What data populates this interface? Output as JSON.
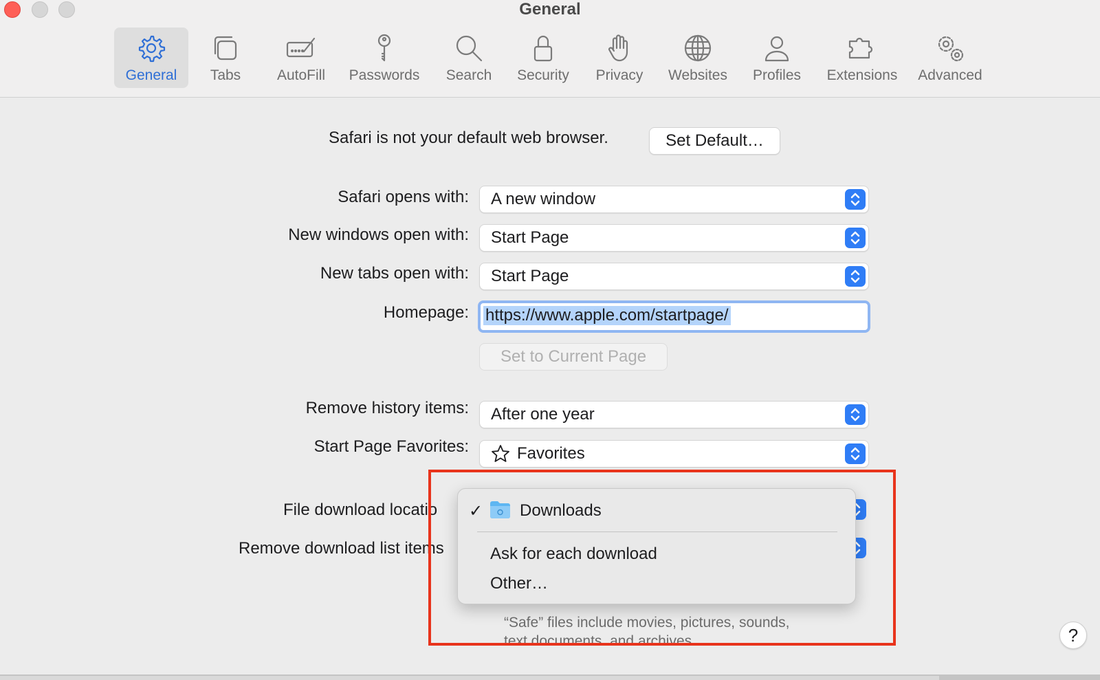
{
  "window": {
    "title": "General"
  },
  "toolbar": {
    "tabs": [
      {
        "label": "General",
        "icon": "gear-icon",
        "active": true
      },
      {
        "label": "Tabs",
        "icon": "tabs-icon"
      },
      {
        "label": "AutoFill",
        "icon": "autofill-icon"
      },
      {
        "label": "Passwords",
        "icon": "key-icon"
      },
      {
        "label": "Search",
        "icon": "magnifier-icon"
      },
      {
        "label": "Security",
        "icon": "lock-icon"
      },
      {
        "label": "Privacy",
        "icon": "hand-icon"
      },
      {
        "label": "Websites",
        "icon": "globe-icon"
      },
      {
        "label": "Profiles",
        "icon": "person-icon"
      },
      {
        "label": "Extensions",
        "icon": "puzzle-icon"
      },
      {
        "label": "Advanced",
        "icon": "gears-icon"
      }
    ]
  },
  "default_browser": {
    "message": "Safari is not your default web browser.",
    "button": "Set Default…"
  },
  "settings": {
    "opens_with": {
      "label": "Safari opens with:",
      "value": "A new window"
    },
    "new_windows": {
      "label": "New windows open with:",
      "value": "Start Page"
    },
    "new_tabs": {
      "label": "New tabs open with:",
      "value": "Start Page"
    },
    "homepage": {
      "label": "Homepage:",
      "value": "https://www.apple.com/startpage/",
      "set_current": "Set to Current Page"
    },
    "remove_history": {
      "label": "Remove history items:",
      "value": "After one year"
    },
    "favorites": {
      "label": "Start Page Favorites:",
      "value": "Favorites",
      "icon": "star-icon"
    },
    "download_location": {
      "label": "File download location:",
      "visible_label": "File download locatio"
    },
    "remove_download": {
      "label": "Remove download list items:",
      "visible_label": "Remove download list items"
    }
  },
  "menu": {
    "items": [
      {
        "label": "Downloads",
        "checked": true,
        "icon": "folder-icon"
      },
      {
        "label": "Ask for each download"
      },
      {
        "label": "Other…"
      }
    ]
  },
  "note": {
    "line1": "“Safe” files include movies, pictures, sounds,",
    "line2": "text documents, and archives."
  },
  "help": {
    "label": "?"
  },
  "colors": {
    "accent": "#2f7df6",
    "annotation": "#e8341c",
    "selection": "#b4d4fb"
  }
}
